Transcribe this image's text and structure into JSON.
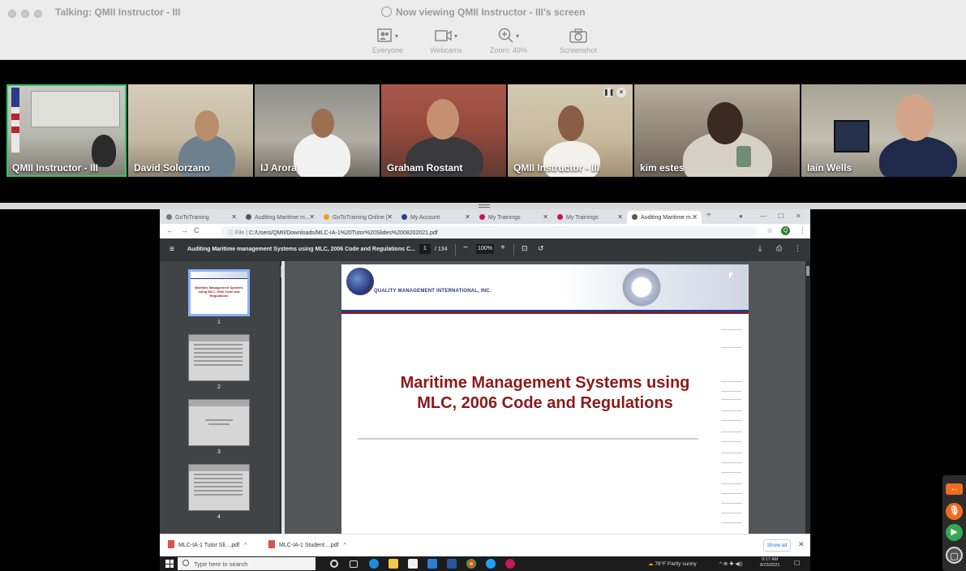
{
  "window": {
    "title": "Talking: QMII Instructor - III",
    "viewing": "Now viewing QMII Instructor - III's screen"
  },
  "toolbar": {
    "everyone": "Everyone",
    "webcams": "Webcams",
    "zoom": "Zoom: 49%",
    "screenshot": "Screenshot"
  },
  "participants": [
    {
      "name": "QMII Instructor - III"
    },
    {
      "name": "David Solorzano"
    },
    {
      "name": "IJ Arora"
    },
    {
      "name": "Graham Rostant"
    },
    {
      "name": "QMII Instructor - III"
    },
    {
      "name": "kim estes"
    },
    {
      "name": "Iain Wells"
    }
  ],
  "browser": {
    "tabs": [
      {
        "label": "GoToTraining"
      },
      {
        "label": "Auditing Maritime m..."
      },
      {
        "label": "GoToTraining Online |"
      },
      {
        "label": "My Account"
      },
      {
        "label": "My Trainings"
      },
      {
        "label": "My Trainings"
      },
      {
        "label": "Auditing Maritime m..."
      }
    ],
    "url_scheme": "File",
    "url": "C:/Users/QMII/Downloads/MLC-IA-1%20Tutor%20Slides%2008202021.pdf"
  },
  "pdf": {
    "title": "Auditing Maritime management Systems using MLC, 2006 Code and Regulations C...",
    "page": "1",
    "total": "/ 134",
    "zoom": "100%",
    "thumb_numbers": [
      "1",
      "2",
      "3",
      "4"
    ],
    "company": "QUALITY MANAGEMENT INTERNATIONAL, INC.",
    "slide_title_line1": "Maritime Management Systems using",
    "slide_title_line2": "MLC, 2006 Code and Regulations",
    "thumb1_title": "Maritime Management Systems using MLC, 2006 Code and Regulations"
  },
  "downloads": [
    {
      "name": "MLC-IA-1 Tutor Sli....pdf"
    },
    {
      "name": "MLC-IA-1 Student....pdf"
    }
  ],
  "show_all": "Show all",
  "taskbar": {
    "search_placeholder": "Type here to search",
    "weather": "78°F  Partly sunny",
    "time": "9:17 AM",
    "date": "8/23/2021"
  },
  "colors": {
    "active_cam": "#34c36b",
    "slide_title": "#8b1a1a",
    "pdf_toolbar": "#323639"
  }
}
